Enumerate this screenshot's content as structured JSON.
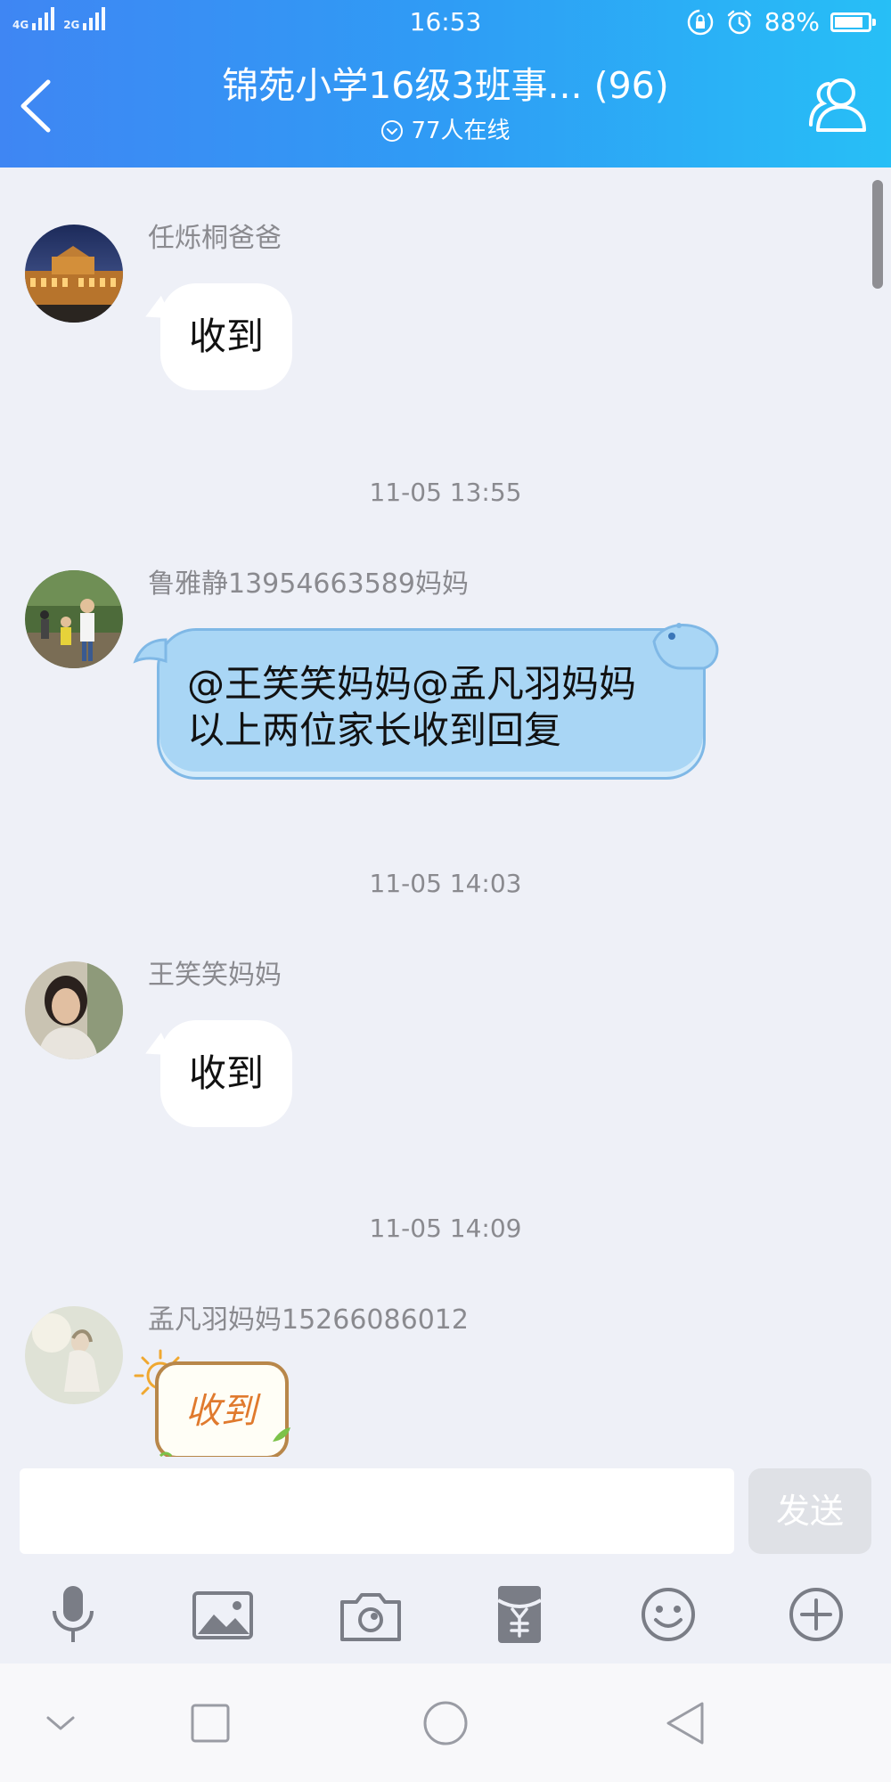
{
  "status_bar": {
    "network_1": "4G",
    "network_2": "2G",
    "time": "16:53",
    "battery": "88%",
    "battery_level_percent": 88,
    "icons": [
      "lock-rotation-icon",
      "alarm-icon",
      "battery-icon"
    ]
  },
  "header": {
    "title": "锦苑小学16级3班事... (96)",
    "online": "77人在线",
    "icons": [
      "back-chevron-icon",
      "chevron-circle-icon",
      "group-members-icon"
    ]
  },
  "messages": [
    {
      "sender": "任烁桐爸爸",
      "text": "收到",
      "type": "text",
      "avatar": "avatar-louvre-night"
    },
    {
      "timestamp": "11-05 13:55"
    },
    {
      "sender": "鲁雅静13954663589妈妈",
      "lines": [
        "@王笑笑妈妈@孟凡羽妈妈",
        "以上两位家长收到回复"
      ],
      "type": "bubble-blue",
      "avatar": "avatar-park-people"
    },
    {
      "timestamp": "11-05 14:03"
    },
    {
      "sender": "王笑笑妈妈",
      "text": "收到",
      "type": "text",
      "avatar": "avatar-woman-portrait"
    },
    {
      "timestamp": "11-05 14:09"
    },
    {
      "sender": "孟凡羽妈妈15266086012",
      "sticker_text": "收到",
      "type": "sticker",
      "avatar": "avatar-girl-sketch"
    }
  ],
  "input": {
    "value": "",
    "placeholder": "",
    "send_label": "发送"
  },
  "toolbar": {
    "icons": [
      "microphone-icon",
      "image-icon",
      "camera-icon",
      "red-packet-icon",
      "emoji-icon",
      "plus-icon"
    ]
  },
  "nav": {
    "icons": [
      "chevron-down-icon",
      "square-icon",
      "circle-icon",
      "triangle-back-icon"
    ]
  },
  "colors": {
    "header_start": "#3f86f3",
    "header_end": "#27bff6",
    "chat_bg": "#eef0f7",
    "bubble_blue": "#a9d6f5",
    "send_disabled": "#dfe1e6"
  }
}
